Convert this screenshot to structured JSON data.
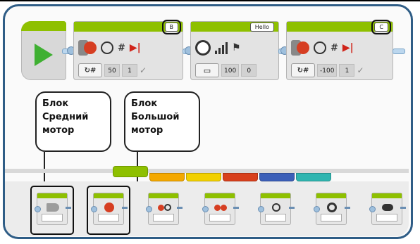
{
  "program": {
    "start_block": {
      "icon": "play-icon"
    },
    "blocks": [
      {
        "type": "large-motor",
        "port": "B",
        "mode_icon": "degrees-mode-icon",
        "params": [
          "50",
          "1"
        ],
        "icons": [
          "large-motor-icon",
          "power-gauge-icon",
          "hash-icon",
          "brake-icon"
        ]
      },
      {
        "type": "sound",
        "port": "Hello",
        "mode_icon": "folder-mode-icon",
        "params": [
          "100",
          "0"
        ],
        "icons": [
          "speaker-icon",
          "volume-bars-icon",
          "flag-icon"
        ]
      },
      {
        "type": "large-motor",
        "port": "C",
        "mode_icon": "degrees-mode-icon",
        "params": [
          "-100",
          "1"
        ],
        "icons": [
          "large-motor-icon",
          "power-gauge-icon",
          "hash-icon",
          "brake-icon"
        ]
      }
    ]
  },
  "callouts": {
    "medium": {
      "line1": "Блок",
      "line2": "Средний",
      "line3": "мотор"
    },
    "large": {
      "line1": "Блок",
      "line2": "Большой",
      "line3": "мотор"
    }
  },
  "palette": {
    "tabs": [
      {
        "color": "#8ec000",
        "active": true
      },
      {
        "color": "#f4a800"
      },
      {
        "color": "#f2d000"
      },
      {
        "color": "#d8401c"
      },
      {
        "color": "#3b5fb8"
      },
      {
        "color": "#2fb5b0"
      }
    ],
    "blocks": [
      {
        "icon": "medium-motor-icon"
      },
      {
        "icon": "large-motor-icon"
      },
      {
        "icon": "move-steering-icon"
      },
      {
        "icon": "move-tank-icon"
      },
      {
        "icon": "display-icon"
      },
      {
        "icon": "sound-icon"
      },
      {
        "icon": "brick-status-light-icon"
      }
    ]
  },
  "colors": {
    "frame": "#2f5d86",
    "action_green": "#8ec000",
    "play_green": "#3fb032",
    "motor_red": "#d63e22"
  }
}
